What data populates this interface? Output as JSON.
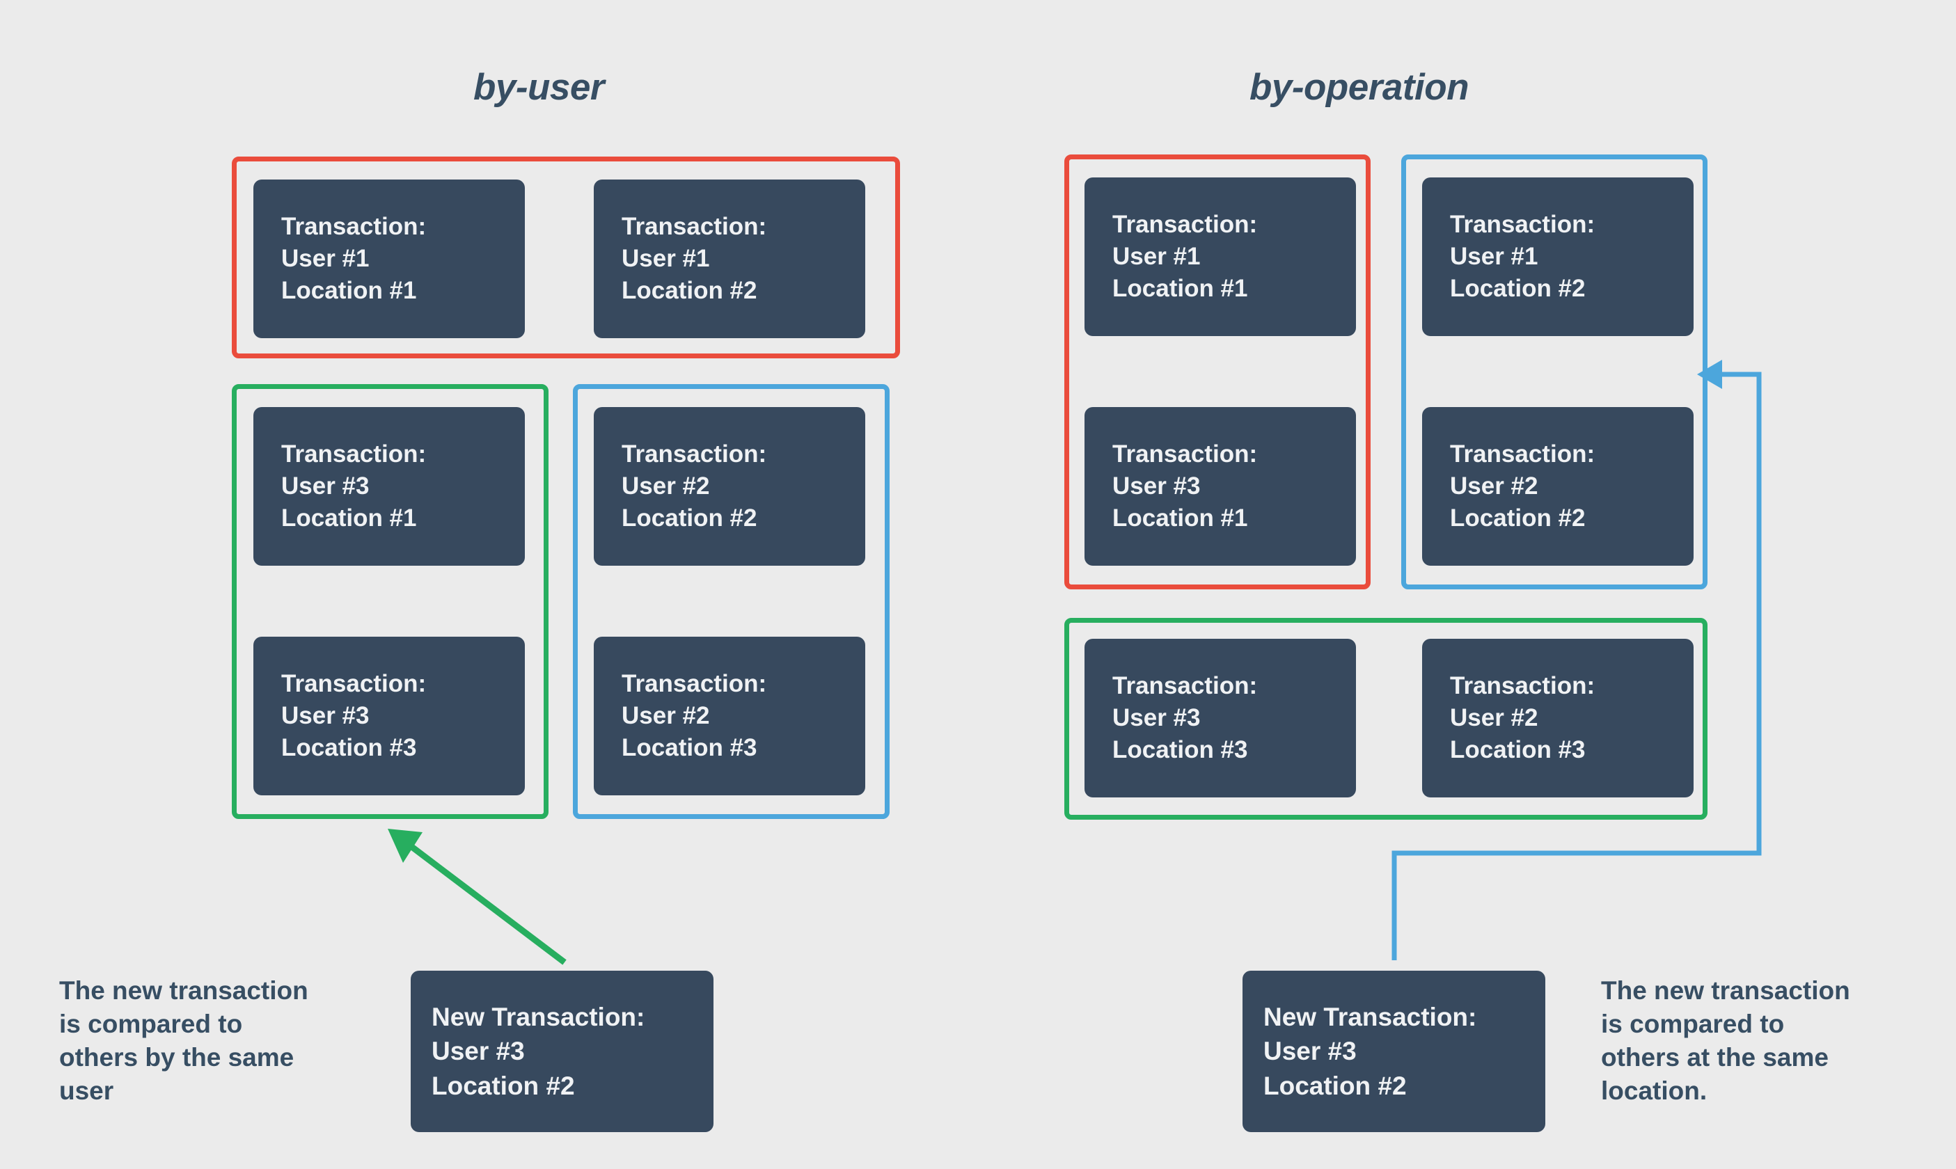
{
  "background_color": "#ebebeb",
  "colors": {
    "card_fill": "#37495e",
    "card_text": "#f0f2f4",
    "title_text": "#374e63",
    "group_red": "#ea4c3c",
    "group_green": "#27ae5f",
    "group_blue": "#4ca6dc"
  },
  "panels": {
    "left": {
      "title": "by-user",
      "groups": [
        {
          "color_name": "red",
          "grouping_key": "User #1",
          "cards": [
            {
              "l1": "Transaction:",
              "l2": "User #1",
              "l3": "Location #1"
            },
            {
              "l1": "Transaction:",
              "l2": "User #1",
              "l3": "Location #2"
            }
          ]
        },
        {
          "color_name": "green",
          "grouping_key": "User #3",
          "cards": [
            {
              "l1": "Transaction:",
              "l2": "User #3",
              "l3": "Location #1"
            },
            {
              "l1": "Transaction:",
              "l2": "User #3",
              "l3": "Location #3"
            }
          ]
        },
        {
          "color_name": "blue",
          "grouping_key": "User #2",
          "cards": [
            {
              "l1": "Transaction:",
              "l2": "User #2",
              "l3": "Location #2"
            },
            {
              "l1": "Transaction:",
              "l2": "User #2",
              "l3": "Location #3"
            }
          ]
        }
      ],
      "new_transaction": {
        "l1": "New Transaction:",
        "l2": "User #3",
        "l3": "Location #2"
      },
      "caption": {
        "l1": "The new transaction",
        "l2": "is compared to",
        "l3": "others by the same",
        "l4": "user"
      },
      "connector": {
        "color_name": "green",
        "style": "diagonal-arrow",
        "points_to": "green-group"
      }
    },
    "right": {
      "title": "by-operation",
      "groups": [
        {
          "color_name": "red",
          "grouping_key": "Location #1",
          "cards": [
            {
              "l1": "Transaction:",
              "l2": "User #1",
              "l3": "Location #1"
            },
            {
              "l1": "Transaction:",
              "l2": "User #3",
              "l3": "Location #1"
            }
          ]
        },
        {
          "color_name": "blue",
          "grouping_key": "Location #2",
          "cards": [
            {
              "l1": "Transaction:",
              "l2": "User #1",
              "l3": "Location #2"
            },
            {
              "l1": "Transaction:",
              "l2": "User #2",
              "l3": "Location #2"
            }
          ]
        },
        {
          "color_name": "green",
          "grouping_key": "Location #3",
          "cards": [
            {
              "l1": "Transaction:",
              "l2": "User #3",
              "l3": "Location #3"
            },
            {
              "l1": "Transaction:",
              "l2": "User #2",
              "l3": "Location #3"
            }
          ]
        }
      ],
      "new_transaction": {
        "l1": "New Transaction:",
        "l2": "User #3",
        "l3": "Location #2"
      },
      "caption": {
        "l1": "The new transaction",
        "l2": "is compared to",
        "l3": "others at the same",
        "l4": "location."
      },
      "connector": {
        "color_name": "blue",
        "style": "elbow-arrow",
        "points_to": "blue-group"
      }
    }
  }
}
